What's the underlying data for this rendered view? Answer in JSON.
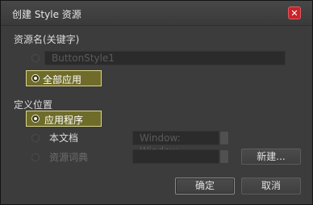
{
  "dialog": {
    "title": "创建 Style 资源",
    "close_glyph": "✕"
  },
  "resource_name": {
    "label": "资源名(关键字)",
    "key_value": "ButtonStyle1",
    "apply_all_label": "全部应用"
  },
  "definition_location": {
    "label": "定义位置",
    "options": [
      {
        "label": "应用程序",
        "selected": true,
        "enabled": true
      },
      {
        "label": "本文档",
        "selected": false,
        "enabled": true
      },
      {
        "label": "资源词典",
        "selected": false,
        "enabled": false
      }
    ],
    "document_combo_value": "Window: Window",
    "dictionary_combo_value": "",
    "new_button": "新建..."
  },
  "footer": {
    "ok": "确定",
    "cancel": "取消"
  },
  "colors": {
    "accent_fill": "#6f6c2a",
    "accent_border": "#d8d58a",
    "close_red": "#c8242b"
  }
}
